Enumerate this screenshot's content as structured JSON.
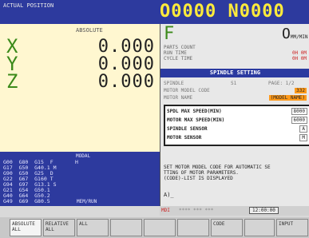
{
  "header": {
    "position_label": "ACTUAL POSITION",
    "program_number": "O0000 N0000"
  },
  "position": {
    "mode_label": "ABSOLUTE",
    "axes": [
      {
        "name": "X",
        "value": "0.000"
      },
      {
        "name": "Y",
        "value": "0.000"
      },
      {
        "name": "Z",
        "value": "0.000"
      }
    ]
  },
  "modal": {
    "title": "MODAL",
    "rows": [
      "G00  G80  G15  F       H",
      "G17  G50  G40.1 M",
      "G90  G50  G25  D",
      "G22  G67  G160 T",
      "G94  G97  G13.1 S",
      "G21  G54  G50.1",
      "G40  G64  G50.2",
      "G49  G69  G80.5"
    ],
    "mode_text": "MEM/RUN"
  },
  "right": {
    "f_label": "F",
    "o_label": "O",
    "o_small": "MM/MIN",
    "info": [
      "PARTS COUNT",
      "RUN TIME",
      "CYCLE TIME"
    ],
    "info_values": [
      "0H 0M",
      "0H 0M"
    ],
    "spindle_title": "SPINDLE SETTING",
    "params": [
      {
        "label": "SPINDLE",
        "value": "S1",
        "extra": "PAGE: 1/2"
      },
      {
        "label": "MOTOR MODEL CODE",
        "value": "332",
        "highlight": true
      },
      {
        "label": "MOTOR NAME",
        "value": "(MODEL NAME)",
        "highlight": true
      }
    ],
    "box_rows": [
      {
        "label": "SPDL MAX SPEED(MIN)",
        "value": "8000"
      },
      {
        "label": "MOTOR MAX SPEED(MIN)",
        "value": "6000"
      },
      {
        "label": "SPINDLE SENSOR",
        "value": "A"
      },
      {
        "label": "MOTOR SENSOR",
        "value": "M"
      }
    ],
    "message_lines": [
      "SET MOTOR MODEL CODE FOR AUTOMATIC SE",
      "TTING OF MOTOR PARAMETERS.",
      "(CODE)-LIST IS DISPLAYED"
    ],
    "prompt": "A)_"
  },
  "status": {
    "mode": "MDI",
    "dots": "**** *** ***",
    "time": "12:00:00"
  },
  "softkeys": [
    {
      "label": "ABSOLUTE",
      "sub": "ALL"
    },
    {
      "label": "RELATIVE",
      "sub": "ALL"
    },
    {
      "label": "ALL",
      "sub": ""
    },
    {
      "label": "",
      "sub": ""
    },
    {
      "label": "",
      "sub": ""
    },
    {
      "label": "",
      "sub": ""
    },
    {
      "label": "CODE",
      "sub": ""
    },
    {
      "label": "",
      "sub": ""
    },
    {
      "label": "INPUT",
      "sub": ""
    }
  ]
}
